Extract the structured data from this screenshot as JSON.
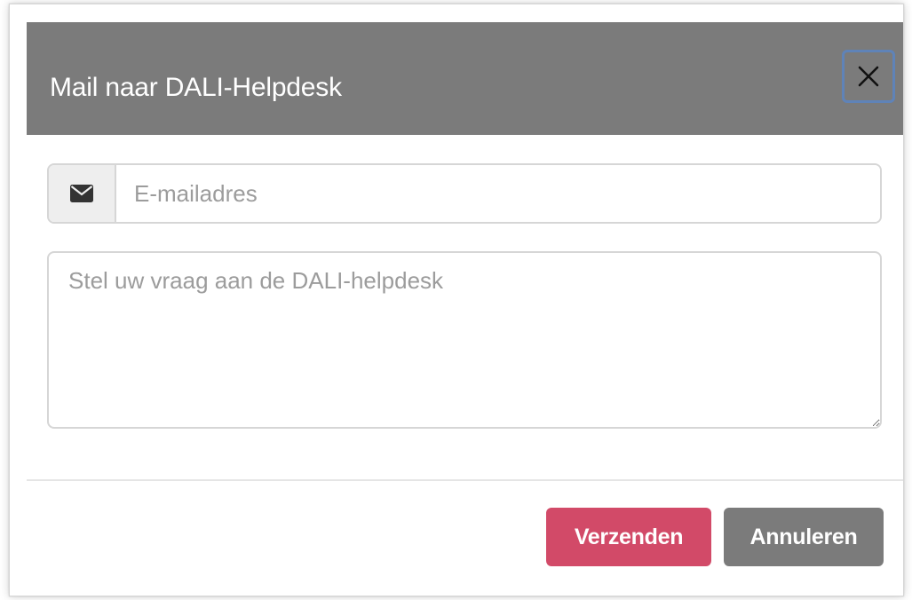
{
  "dialog": {
    "title": "Mail naar DALI-Helpdesk",
    "close_icon": "close-icon"
  },
  "form": {
    "email": {
      "icon": "envelope-icon",
      "placeholder": "E-mailadres",
      "value": ""
    },
    "question": {
      "placeholder": "Stel uw vraag aan de DALI-helpdesk",
      "value": ""
    }
  },
  "footer": {
    "send_label": "Verzenden",
    "cancel_label": "Annuleren"
  },
  "colors": {
    "header_bg": "#7b7b7b",
    "primary": "#d24a68",
    "secondary": "#7b7b7b",
    "focus_ring": "#5f83b8"
  }
}
